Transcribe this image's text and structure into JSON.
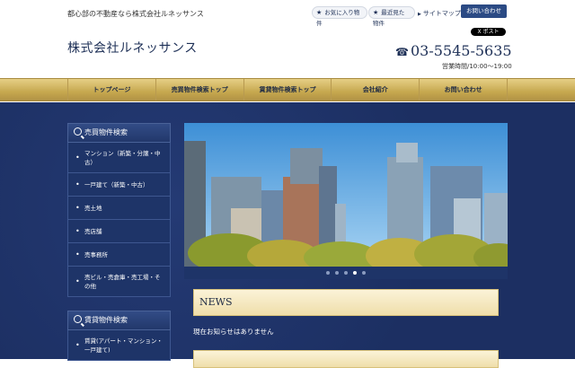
{
  "header": {
    "tagline": "都心部の不動産なら株式会社ルネッサンス",
    "company_name": "株式会社ルネッサンス",
    "favorites_label": "お気に入り物件",
    "recent_label": "最近見た物件",
    "sitemap_label": "サイトマップ",
    "contact_label": "お問い合わせ",
    "x_post_label": "X ポスト",
    "phone": "03-5545-5635",
    "hours": "営業時間/10:00〜19:00"
  },
  "nav": {
    "items": [
      {
        "label": "トップページ"
      },
      {
        "label": "売買物件検索トップ"
      },
      {
        "label": "賃貸物件検索トップ"
      },
      {
        "label": "会社紹介"
      },
      {
        "label": "お問い合わせ"
      }
    ]
  },
  "sidebar": {
    "sale": {
      "heading": "売買物件検索",
      "items": [
        {
          "label": "マンション（新築・分譲・中古）"
        },
        {
          "label": "一戸建て（新築・中古）"
        },
        {
          "label": "売土地"
        },
        {
          "label": "売店舗"
        },
        {
          "label": "売事務所"
        },
        {
          "label": "売ビル・売倉庫・売工場・その他"
        }
      ]
    },
    "rent": {
      "heading": "賃貸物件検索",
      "items": [
        {
          "label": "賃貸(アパート・マンション・一戸建て)"
        }
      ]
    }
  },
  "slider": {
    "dots": [
      {
        "active": false
      },
      {
        "active": false
      },
      {
        "active": false
      },
      {
        "active": true
      },
      {
        "active": false
      }
    ]
  },
  "news": {
    "heading": "NEWS",
    "body": "現在お知らせはありません"
  },
  "colors": {
    "navy": "#1c2f62",
    "gold": "#c6a84f",
    "button_blue": "#2b4a84"
  },
  "icons": {
    "favorites": "star-icon",
    "recent": "star-icon",
    "phone": "phone-icon",
    "search": "search-icon"
  }
}
